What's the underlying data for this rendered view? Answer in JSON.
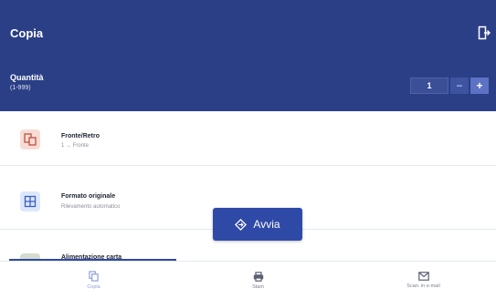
{
  "header": {
    "title": "Copia",
    "exit_icon": "logout-icon",
    "quantity_label": "Quantità",
    "quantity_range": "(1-999)",
    "quantity_value": "1",
    "minus_label": "−",
    "plus_label": "+"
  },
  "options": [
    {
      "title": "Fronte/Retro",
      "subtitle": "1 → Fronte",
      "icon": "duplex-icon"
    },
    {
      "title": "Formato originale",
      "subtitle": "Rilevamento automatico",
      "icon": "original-size-icon"
    },
    {
      "title": "Alimentazione carta",
      "subtitle": "",
      "icon": "paper-tray-icon"
    }
  ],
  "action": {
    "label": "Avvia",
    "icon": "start-icon"
  },
  "nav": [
    {
      "label": "Copia",
      "icon": "copy-icon",
      "active": true
    },
    {
      "label": "Stam",
      "icon": "print-icon",
      "active": false
    },
    {
      "label": "Scan. in e-mail",
      "icon": "mail-icon",
      "active": false
    }
  ],
  "colors": {
    "header": "#2a3f86",
    "accent": "#2f4aa6",
    "duplex_icon_bg": "#f7dcd6",
    "duplex_icon_fg": "#c0503a",
    "format_icon_bg": "#dde7fb",
    "format_icon_fg": "#3a5fc4"
  }
}
